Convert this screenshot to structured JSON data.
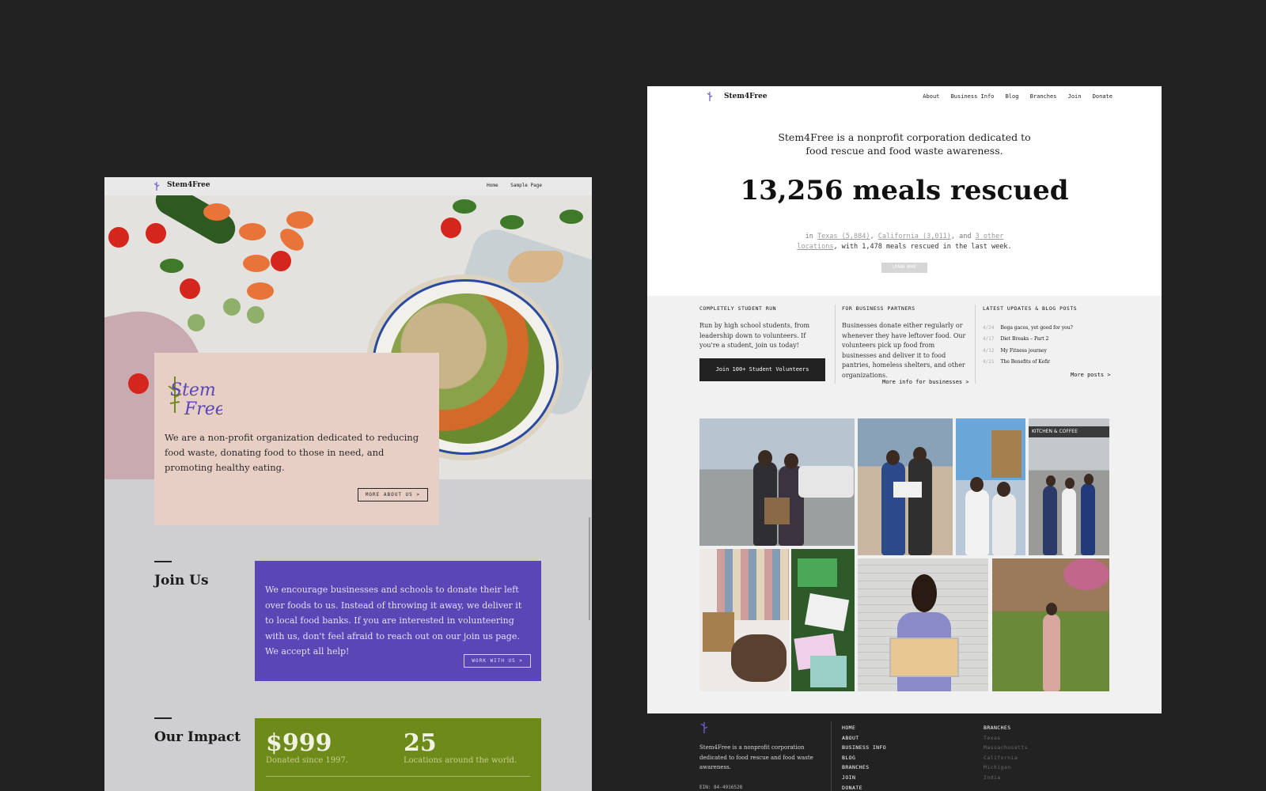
{
  "left_site": {
    "brand": "Stem4Free",
    "nav": [
      "Home",
      "Sample Page"
    ],
    "hero_card": {
      "logo_text_1": "Stem",
      "logo_text_2": "Free",
      "description": "We are a non-profit organization dedicated to reducing food waste, donating food to those in need, and promoting healthy eating.",
      "button": "MORE ABOUT US >"
    },
    "join": {
      "title": "Join Us",
      "text": "We encourage businesses and schools to donate their left over foods to us. Instead of throwing it away, we deliver it to local food banks. If you are interested in volunteering with us, don't feel afraid to reach out on our join us page. We accept all help!",
      "button": "WORK WITH US >"
    },
    "impact": {
      "title": "Our Impact",
      "stats": [
        {
          "value": "$999",
          "label": "Donated since 1997."
        },
        {
          "value": "25",
          "label": "Locations around the world."
        }
      ]
    }
  },
  "right_site": {
    "brand": "Stem4Free",
    "nav": [
      "About",
      "Business Info",
      "Blog",
      "Branches",
      "Join",
      "Donate"
    ],
    "lede": "Stem4Free is a nonprofit corporation dedicated to food rescue and food waste awareness.",
    "headline": "13,256 meals rescued",
    "meta": {
      "prefix": "in",
      "loc1": "Texas (5,884)",
      "loc2": "California (3,011)",
      "joiner": ", and",
      "loc3": "3 other locations",
      "suffix": ", with 1,478 meals rescued in the last week."
    },
    "learn_more": "LEARN MORE",
    "columns": {
      "student": {
        "heading": "COMPLETELY STUDENT RUN",
        "text": "Run by high school students, from leadership down to volunteers. If you're a student, join us today!",
        "button": "Join 100+ Student Volunteers"
      },
      "business": {
        "heading": "FOR BUSINESS PARTNERS",
        "text": "Businesses donate either regularly or whenever they have leftover food. Our volunteers pick up food from businesses and deliver it to food pantries, homeless shelters, and other organizations.",
        "link": "More info for businesses >"
      },
      "blog": {
        "heading": "LATEST UPDATES & BLOG POSTS",
        "posts": [
          {
            "date": "4/24",
            "title": "Boga gacos, yet good for you?"
          },
          {
            "date": "4/17",
            "title": "Diet Breaks – Part 2"
          },
          {
            "date": "4/12",
            "title": "My Fitness journey"
          },
          {
            "date": "4/21",
            "title": "The Benefits of Kefir"
          }
        ],
        "link": "More posts >"
      }
    },
    "photo_signs": {
      "coffee": "KITCHEN & COFFEE"
    },
    "footer": {
      "about": "Stem4Free is a nonprofit corporation dedicated to food rescue and food waste awareness.",
      "ein": "EIN: 84-4916528",
      "links": [
        "HOME",
        "ABOUT",
        "BUSINESS INFO",
        "BLOG",
        "BRANCHES",
        "JOIN",
        "DONATE"
      ],
      "branches_title": "BRANCHES",
      "branches": [
        "Texas",
        "Massachusetts",
        "California",
        "Michigan",
        "India"
      ]
    }
  },
  "colors": {
    "background": "#222222",
    "card_pink": "#e8cfc6",
    "join_purple": "#5b46b5",
    "impact_green": "#6e8a1a"
  }
}
